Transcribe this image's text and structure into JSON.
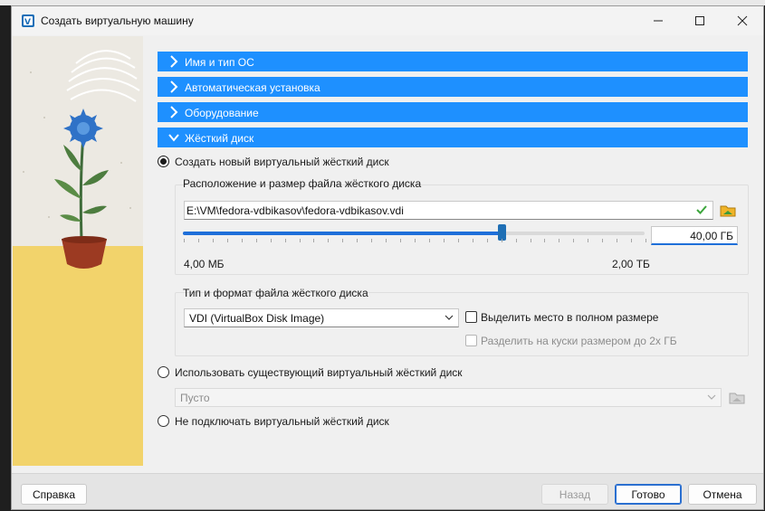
{
  "window": {
    "title": "Создать виртуальную машину",
    "icon": "virtualbox-app-icon"
  },
  "sections": [
    {
      "label": "Имя и тип ОС",
      "expanded": false
    },
    {
      "label": "Автоматическая установка",
      "expanded": false
    },
    {
      "label": "Оборудование",
      "expanded": false
    },
    {
      "label": "Жёсткий диск",
      "expanded": true
    }
  ],
  "disk": {
    "option_create": "Создать новый виртуальный жёсткий диск",
    "location_group_label": "Расположение и размер файла жёсткого диска",
    "path": "E:\\VM\\fedora-vdbikasov\\fedora-vdbikasov.vdi",
    "size_value": "40,00 ГБ",
    "size_fraction": 0.69,
    "min_label": "4,00 МБ",
    "max_label": "2,00 ТБ",
    "format_group_label": "Тип и формат файла жёсткого диска",
    "format_selected": "VDI (VirtualBox Disk Image)",
    "preallocate_label": "Выделить место в полном размере",
    "split_label": "Разделить на куски размером до 2х ГБ",
    "option_existing": "Использовать существующий виртуальный жёсткий диск",
    "existing_placeholder": "Пусто",
    "option_none": "Не подключать виртуальный жёсткий диск"
  },
  "buttons": {
    "help": "Справка",
    "back": "Назад",
    "finish": "Готово",
    "cancel": "Отмена"
  },
  "colors": {
    "accent": "#1e90ff",
    "artwork_yellow": "#f2d36b"
  }
}
